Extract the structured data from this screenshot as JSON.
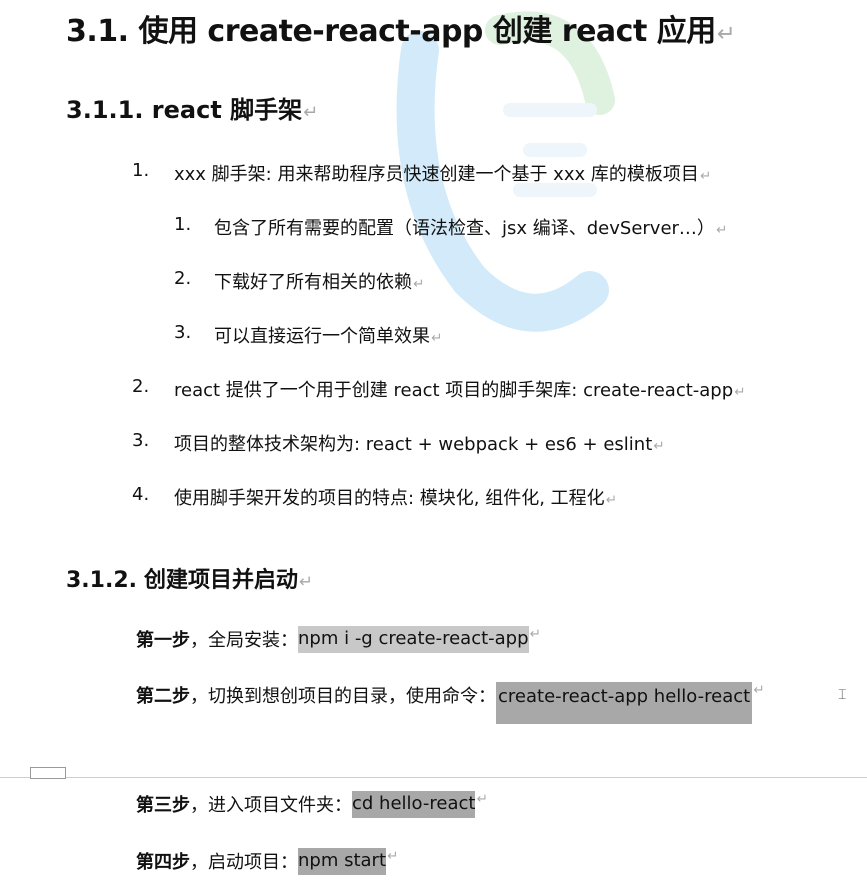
{
  "heading1": {
    "text": "3.1. 使用 create-react-app 创建 react 应用",
    "mark": "↵"
  },
  "heading2": {
    "text": "3.1.1. react 脚手架",
    "mark": "↵"
  },
  "list": [
    {
      "num": "1.",
      "text": "xxx 脚手架: 用来帮助程序员快速创建一个基于 xxx 库的模板项目",
      "mark": "↵"
    },
    {
      "num": "1.",
      "text": "包含了所有需要的配置（语法检查、jsx 编译、devServer…）",
      "mark": "↵"
    },
    {
      "num": "2.",
      "text": "下载好了所有相关的依赖",
      "mark": "↵"
    },
    {
      "num": "3.",
      "text": "可以直接运行一个简单效果",
      "mark": "↵"
    },
    {
      "num": "2.",
      "text": "react 提供了一个用于创建 react 项目的脚手架库: create-react-app",
      "mark": "↵"
    },
    {
      "num": "3.",
      "text": "项目的整体技术架构为:  react + webpack + es6 + eslint",
      "mark": "↵"
    },
    {
      "num": "4.",
      "text": "使用脚手架开发的项目的特点: 模块化, 组件化, 工程化",
      "mark": "↵"
    }
  ],
  "heading3": {
    "num": "3.1.2.",
    "text": "创建项目并启动",
    "mark": "↵"
  },
  "steps": [
    {
      "label": "第一步",
      "desc": "，全局安装：",
      "code": "npm i -g create-react-app",
      "mark": "↵"
    },
    {
      "label": "第二步",
      "desc": "，切换到想创项目的目录，使用命令：",
      "code": "create-react-app hello-react",
      "mark": "↵"
    },
    {
      "label": "第三步",
      "desc": "，进入项目文件夹：",
      "code": "cd hello-react",
      "mark": "↵"
    },
    {
      "label": "第四步",
      "desc": "，启动项目：",
      "code": "npm start",
      "mark": "↵"
    }
  ]
}
